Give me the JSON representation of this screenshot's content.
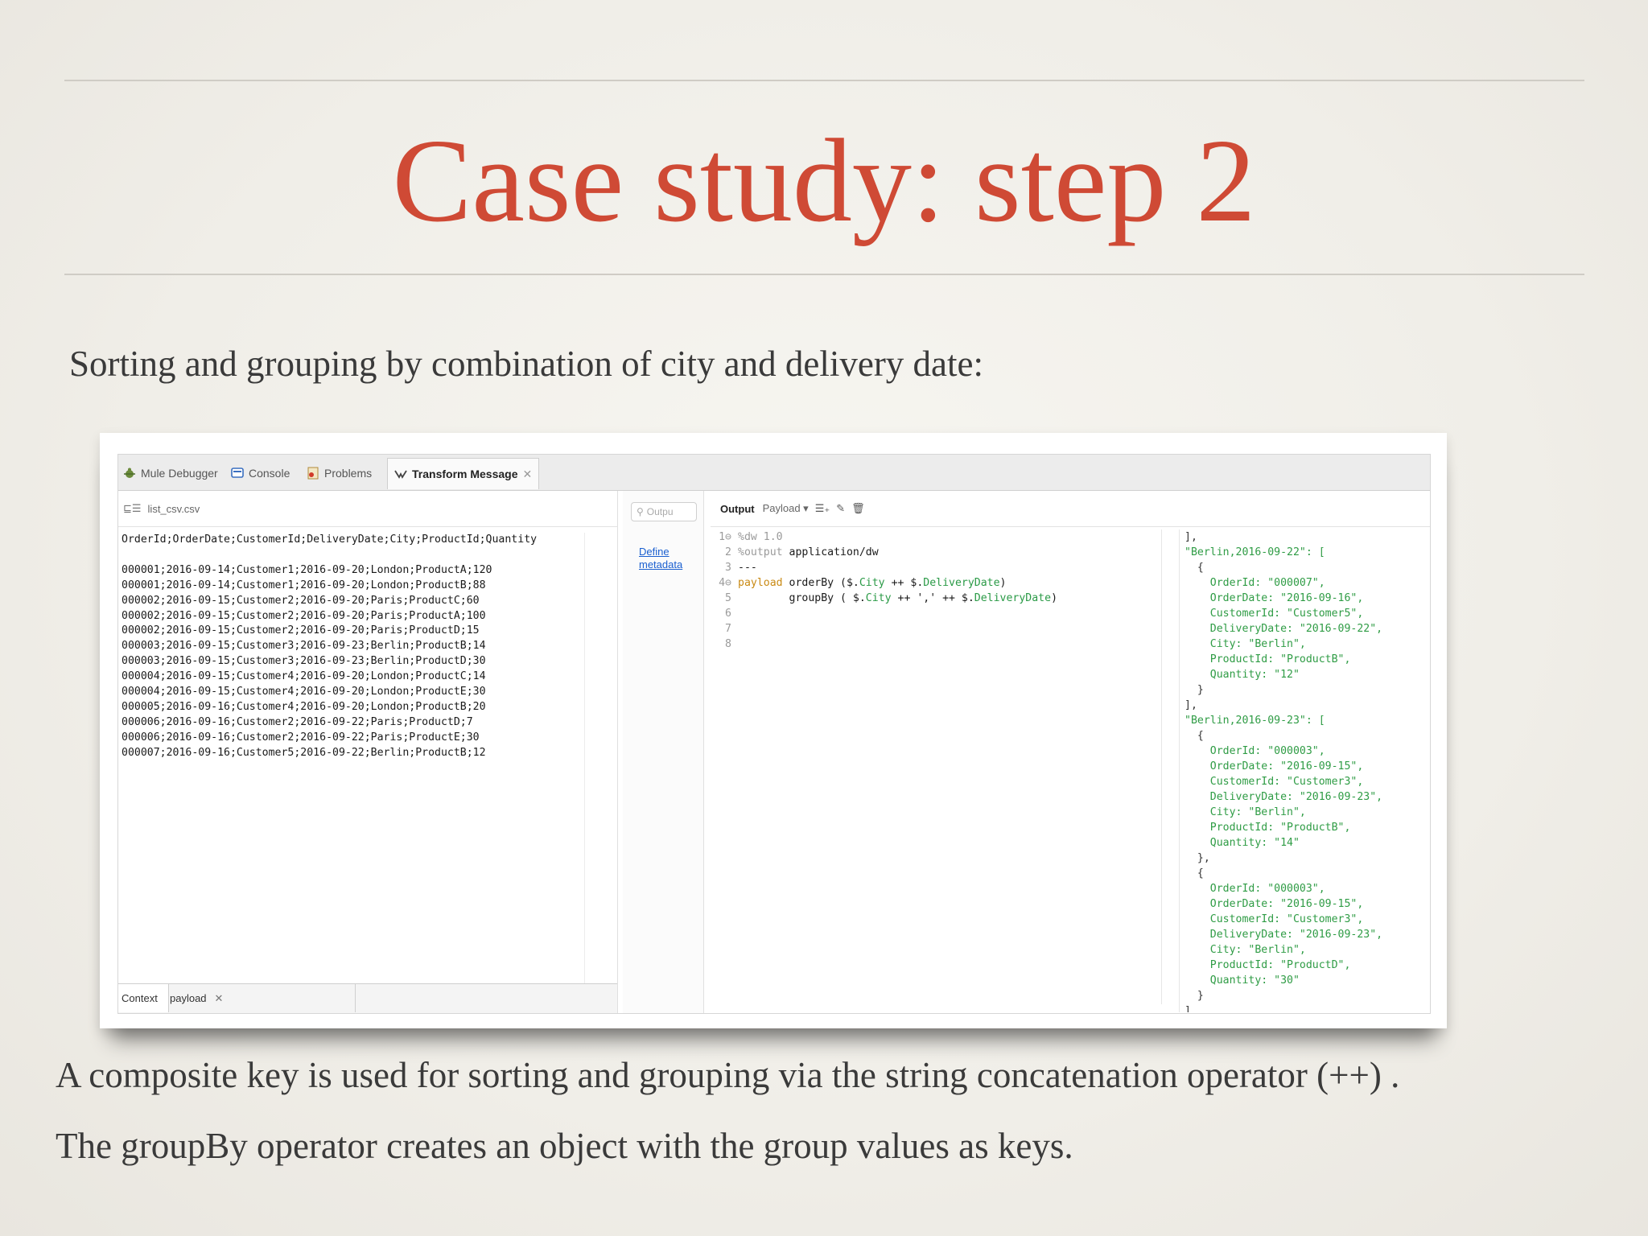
{
  "slide": {
    "title": "Case study: step 2",
    "intro": "Sorting and grouping by combination of city and delivery date:",
    "note1": "A composite key is used for sorting and grouping via the string concatenation operator (++) .",
    "note2": "The groupBy operator creates an object with the group values as keys."
  },
  "ide": {
    "tabs": [
      {
        "label": "Mule Debugger",
        "icon": "bug-icon"
      },
      {
        "label": "Console",
        "icon": "console-icon"
      },
      {
        "label": "Problems",
        "icon": "problems-icon"
      },
      {
        "label": "Transform Message",
        "icon": "transform-icon",
        "active": true
      }
    ],
    "input_file": "list_csv.csv",
    "csv_header": "OrderId;OrderDate;CustomerId;DeliveryDate;City;ProductId;Quantity",
    "csv_rows": [
      "000001;2016-09-14;Customer1;2016-09-20;London;ProductA;120",
      "000001;2016-09-14;Customer1;2016-09-20;London;ProductB;88",
      "000002;2016-09-15;Customer2;2016-09-20;Paris;ProductC;60",
      "000002;2016-09-15;Customer2;2016-09-20;Paris;ProductA;100",
      "000002;2016-09-15;Customer2;2016-09-20;Paris;ProductD;15",
      "000003;2016-09-15;Customer3;2016-09-23;Berlin;ProductB;14",
      "000003;2016-09-15;Customer3;2016-09-23;Berlin;ProductD;30",
      "000004;2016-09-15;Customer4;2016-09-20;London;ProductC;14",
      "000004;2016-09-15;Customer4;2016-09-20;London;ProductE;30",
      "000005;2016-09-16;Customer4;2016-09-20;London;ProductB;20",
      "000006;2016-09-16;Customer2;2016-09-22;Paris;ProductD;7",
      "000006;2016-09-16;Customer2;2016-09-22;Paris;ProductE;30",
      "000007;2016-09-16;Customer5;2016-09-22;Berlin;ProductB;12"
    ],
    "bottom_tabs": {
      "context": "Context",
      "payload": "payload"
    },
    "search_placeholder": "Outpu",
    "define_metadata": {
      "line1": "Define",
      "line2": "metadata"
    },
    "output_label": "Output",
    "payload_select": "Payload ▾",
    "code": {
      "l1_num": "1⊖",
      "l1": "%dw 1.0",
      "l2_num": "2",
      "l2_kw": "%output",
      "l2_rest": " application/dw",
      "l3_num": "3",
      "l3": "---",
      "l4_num": "4⊖",
      "l4_kw": "payload",
      "l4_a": " orderBy ($.",
      "l4_city": "City",
      "l4_b": " ++ $.",
      "l4_dd": "DeliveryDate",
      "l4_c": ")",
      "l5_num": "5",
      "l5_a": "        groupBy ( $.",
      "l5_city": "City",
      "l5_b": " ++ ',' ++ $.",
      "l5_dd": "DeliveryDate",
      "l5_c": ")",
      "l6_num": "6",
      "l7_num": "7",
      "l8_num": "8"
    },
    "json_lines": [
      "],",
      "\"Berlin,2016-09-22\": [",
      "  {",
      "    OrderId: \"000007\",",
      "    OrderDate: \"2016-09-16\",",
      "    CustomerId: \"Customer5\",",
      "    DeliveryDate: \"2016-09-22\",",
      "    City: \"Berlin\",",
      "    ProductId: \"ProductB\",",
      "    Quantity: \"12\"",
      "  }",
      "],",
      "\"Berlin,2016-09-23\": [",
      "  {",
      "    OrderId: \"000003\",",
      "    OrderDate: \"2016-09-15\",",
      "    CustomerId: \"Customer3\",",
      "    DeliveryDate: \"2016-09-23\",",
      "    City: \"Berlin\",",
      "    ProductId: \"ProductB\",",
      "    Quantity: \"14\"",
      "  },",
      "  {",
      "    OrderId: \"000003\",",
      "    OrderDate: \"2016-09-15\",",
      "    CustomerId: \"Customer3\",",
      "    DeliveryDate: \"2016-09-23\",",
      "    City: \"Berlin\",",
      "    ProductId: \"ProductD\",",
      "    Quantity: \"30\"",
      "  }",
      "],"
    ]
  }
}
